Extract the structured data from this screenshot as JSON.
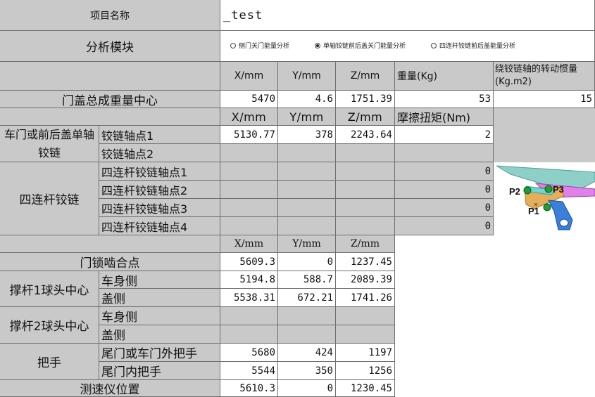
{
  "project": {
    "label": "项目名称",
    "value": "_test"
  },
  "analysis": {
    "label": "分析模块",
    "options": [
      {
        "label": "侧门关门能量分析",
        "selected": false
      },
      {
        "label": "单轴铰链前后盖关门能量分析",
        "selected": true
      },
      {
        "label": "四连杆铰链前后盖能量分析",
        "selected": false
      }
    ]
  },
  "header1": {
    "x": "X/mm",
    "y": "Y/mm",
    "z": "Z/mm",
    "weight": "重量(Kg)",
    "inertia": "绕铰链轴的转动惯量(Kg.m2)"
  },
  "cog": {
    "label": "门盖总成重量中心",
    "x": "5470",
    "y": "4.6",
    "z": "1751.39",
    "weight": "53",
    "inertia": "15"
  },
  "header2": {
    "x": "X/mm",
    "y": "Y/mm",
    "z": "Z/mm",
    "friction": "摩擦扭矩(Nm)"
  },
  "single_hinge": {
    "label": "车门或前后盖单轴铰链",
    "p1": {
      "label": "铰链轴点1",
      "x": "5130.77",
      "y": "378",
      "z": "2243.64",
      "friction": "2"
    },
    "p2": {
      "label": "铰链轴点2",
      "x": "",
      "y": "",
      "z": "",
      "friction": ""
    }
  },
  "four_bar": {
    "label": "四连杆铰链",
    "points": [
      {
        "label": "四连杆铰链轴点1",
        "friction": "0"
      },
      {
        "label": "四连杆铰链轴点2",
        "friction": "0"
      },
      {
        "label": "四连杆铰链轴点3",
        "friction": "0"
      },
      {
        "label": "四连杆铰链轴点4",
        "friction": "0"
      }
    ],
    "diagram_labels": [
      "P2",
      "P3",
      "P1"
    ]
  },
  "header3": {
    "x": "X/mm",
    "y": "Y/mm",
    "z": "Z/mm"
  },
  "latch": {
    "label": "门锁啮合点",
    "x": "5609.3",
    "y": "0",
    "z": "1237.45"
  },
  "strut1": {
    "label": "撑杆1球头中心",
    "body": {
      "label": "车身侧",
      "x": "5194.8",
      "y": "588.7",
      "z": "2089.39"
    },
    "lid": {
      "label": "盖侧",
      "x": "5538.31",
      "y": "672.21",
      "z": "1741.26"
    }
  },
  "strut2": {
    "label": "撑杆2球头中心",
    "body": {
      "label": "车身侧"
    },
    "lid": {
      "label": "盖侧"
    }
  },
  "handle": {
    "label": "把手",
    "outer": {
      "label": "尾门或车门外把手",
      "x": "5680",
      "y": "424",
      "z": "1197"
    },
    "inner": {
      "label": "尾门内把手",
      "x": "5544",
      "y": "350",
      "z": "1256"
    }
  },
  "speedometer": {
    "label": "测速仪位置",
    "x": "5610.3",
    "y": "0",
    "z": "1230.45"
  }
}
